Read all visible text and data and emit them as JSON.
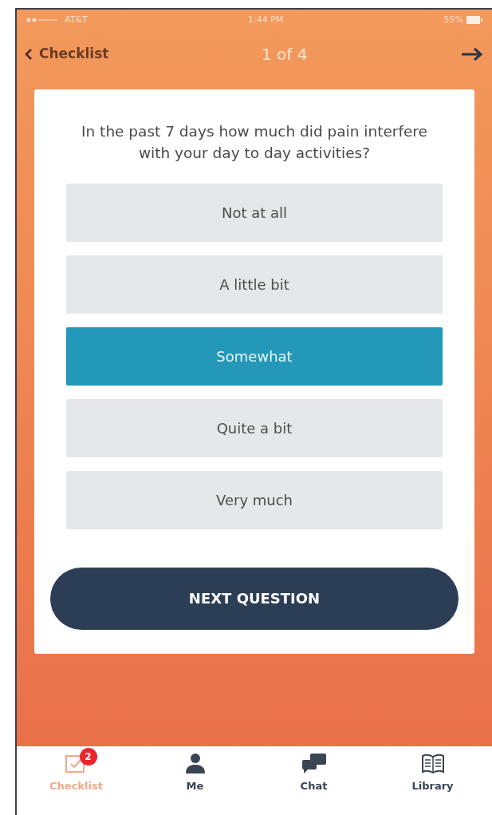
{
  "status_bar": {
    "carrier": "AT&T",
    "time": "1:44 PM",
    "battery": "55%"
  },
  "nav": {
    "back": "Checklist",
    "title": "1 of 4"
  },
  "question": "In the past 7 days how much did pain interfere with your day to day activities?",
  "options": [
    {
      "label": "Not at all",
      "selected": false
    },
    {
      "label": "A little bit",
      "selected": false
    },
    {
      "label": "Somewhat",
      "selected": true
    },
    {
      "label": "Quite a bit",
      "selected": false
    },
    {
      "label": "Very much",
      "selected": false
    }
  ],
  "next_button": "NEXT QUESTION",
  "tabs": [
    {
      "label": "Checklist",
      "kind": "checklist",
      "selected": true,
      "badge": "2"
    },
    {
      "label": "Me",
      "kind": "person",
      "selected": false
    },
    {
      "label": "Chat",
      "kind": "chat",
      "selected": false
    },
    {
      "label": "Library",
      "kind": "book",
      "selected": false
    }
  ]
}
